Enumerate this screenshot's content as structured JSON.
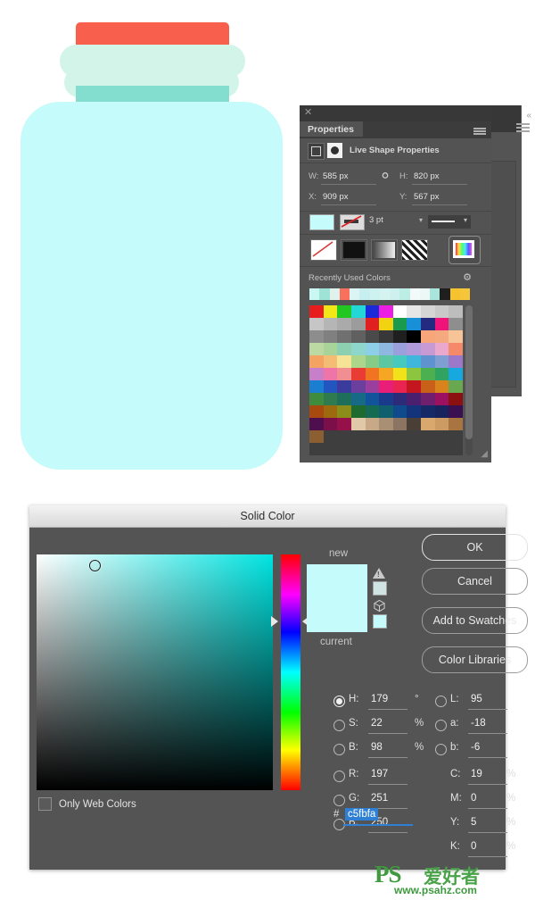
{
  "illustration": {
    "name": "jar-illustration",
    "cap_color": "#f95f4d",
    "lobe_color": "#d3f4e9",
    "neck_color": "#83ded0",
    "body_color": "#c5fbfa"
  },
  "properties_panel": {
    "close_icon": "✕",
    "collapse_icon": "«",
    "tab_label": "Properties",
    "header_label": "Live Shape Properties",
    "dimensions": {
      "w_label": "W:",
      "w_value": "585 px",
      "h_label": "H:",
      "h_value": "820 px",
      "x_label": "X:",
      "x_value": "909 px",
      "y_label": "Y:",
      "y_value": "567 px",
      "link_icon": "link-chain-icon"
    },
    "stroke": {
      "fill_color": "#c5fbfa",
      "stroke_value": "none",
      "width_value": "3 pt",
      "style_value": "solid-line"
    },
    "fill_types": [
      {
        "name": "no-color",
        "label": "No Color"
      },
      {
        "name": "solid-color",
        "label": "Solid Color"
      },
      {
        "name": "gradient",
        "label": "Gradient"
      },
      {
        "name": "pattern",
        "label": "Pattern"
      },
      {
        "name": "color-picker",
        "label": "Color Picker",
        "selected": true
      }
    ],
    "recently_used_label": "Recently Used Colors",
    "gear_icon": "⚙",
    "recent_colors": [
      "#c9f7f2",
      "#9fe3d6",
      "#dff2ee",
      "#f9705c",
      "#daf5f3",
      "#c7efef",
      "#cef2f0",
      "#d4f3f1",
      "#cef0ee",
      "#bdeee6",
      "#f2fbfa",
      "#ecf8f6",
      "#a9e5da",
      "#1f1f1f",
      "#f5c32e",
      "#f6c63a"
    ],
    "swatch_grid": [
      "#e81e1e",
      "#f2e818",
      "#22c722",
      "#23d7d7",
      "#1a2ad6",
      "#ec1ee4",
      "#ffffff",
      "#e6e6e6",
      "#d5d5d5",
      "#c9c9c9",
      "#bdbdbd",
      "#c6c6c6",
      "#b5b5b5",
      "#aaaaaa",
      "#9c9c9c",
      "#e02020",
      "#f2d312",
      "#189b4e",
      "#1790d8",
      "#242a80",
      "#f0147a",
      "#8e8e8e",
      "#8d8d8d",
      "#808080",
      "#707070",
      "#606060",
      "#4a4a4a",
      "#383838",
      "#1f1f1f",
      "#000000",
      "#f8a579",
      "#f5a97e",
      "#f7c498",
      "#bcd9a4",
      "#a8d49a",
      "#8ccfb1",
      "#8ed6cc",
      "#8ccfe7",
      "#8fb8e0",
      "#9b9fdb",
      "#b09ad9",
      "#c79ad3",
      "#eaa8cf",
      "#f58a6a",
      "#f5a363",
      "#f3bd76",
      "#f7e396",
      "#aed68a",
      "#86cc86",
      "#5cc7a0",
      "#47c9bd",
      "#3fb7dd",
      "#5f93cf",
      "#7f9fd2",
      "#9b78c9",
      "#c87fc9",
      "#ef74a8",
      "#f08e92",
      "#e83c34",
      "#f07422",
      "#f5a623",
      "#f2e21a",
      "#8cc63f",
      "#4cb050",
      "#2fa35f",
      "#18a8e0",
      "#1a7fd0",
      "#2255c0",
      "#3b3b9e",
      "#6b3f9e",
      "#9b3f9e",
      "#e81e78",
      "#ea2451",
      "#c3161f",
      "#c9601a",
      "#d8831c",
      "#6aa84f",
      "#3f8c3f",
      "#2f7a4f",
      "#1f6e5a",
      "#166a85",
      "#12549c",
      "#1a3a8c",
      "#2b2b7a",
      "#4a1f6e",
      "#6e1f6e",
      "#9b1060",
      "#8c1010",
      "#a84a0f",
      "#9e6a0f",
      "#8c8c1a",
      "#1f6b2f",
      "#146b52",
      "#0f5f6e",
      "#0f4a8c",
      "#13347a",
      "#142a66",
      "#16235c",
      "#3a1050",
      "#4f0f4f",
      "#7a0f4a",
      "#96104a",
      "#e0c8a8",
      "#c8a987",
      "#a98f74",
      "#8b7562",
      "#4a3f36",
      "#d9a86f",
      "#cc9b63",
      "#a87540",
      "#8c5f33"
    ]
  },
  "dialog": {
    "title": "Solid Color",
    "buttons": {
      "ok": "OK",
      "cancel": "Cancel",
      "add_to_swatches": "Add to Swatches",
      "color_libraries": "Color Libraries"
    },
    "preview": {
      "new_label": "new",
      "current_label": "current",
      "new_color": "#c5fbfa",
      "warning_icon": "out-of-gamut-warning-icon",
      "warning_chip_color": "#cfe3e3",
      "web_icon": "web-safe-cube-icon",
      "web_chip_color": "#c5fbfa"
    },
    "only_web_colors": {
      "label": "Only Web Colors",
      "checked": false
    },
    "fields": {
      "hsb": [
        {
          "key": "H",
          "label": "H:",
          "value": "179",
          "unit": "°",
          "selected": true
        },
        {
          "key": "S",
          "label": "S:",
          "value": "22",
          "unit": "%",
          "selected": false
        },
        {
          "key": "B",
          "label": "B:",
          "value": "98",
          "unit": "%",
          "selected": false
        }
      ],
      "lab": [
        {
          "key": "L",
          "label": "L:",
          "value": "95",
          "unit": "",
          "selected": false
        },
        {
          "key": "a",
          "label": "a:",
          "value": "-18",
          "unit": "",
          "selected": false
        },
        {
          "key": "b",
          "label": "b:",
          "value": "-6",
          "unit": "",
          "selected": false
        }
      ],
      "rgb": [
        {
          "key": "R",
          "label": "R:",
          "value": "197",
          "unit": "",
          "selected": false
        },
        {
          "key": "G",
          "label": "G:",
          "value": "251",
          "unit": "",
          "selected": false
        },
        {
          "key": "B2",
          "label": "B:",
          "value": "250",
          "unit": "",
          "selected": false
        }
      ],
      "cmyk": [
        {
          "key": "C",
          "label": "C:",
          "value": "19",
          "unit": "%"
        },
        {
          "key": "M",
          "label": "M:",
          "value": "0",
          "unit": "%"
        },
        {
          "key": "Y",
          "label": "Y:",
          "value": "5",
          "unit": "%"
        },
        {
          "key": "K",
          "label": "K:",
          "value": "0",
          "unit": "%"
        }
      ],
      "hex": {
        "hash": "#",
        "value": "c5fbfa",
        "selected": true
      }
    }
  },
  "watermark": {
    "ps": "PS",
    "cn": "爱好者",
    "url": "www.psahz.com"
  }
}
